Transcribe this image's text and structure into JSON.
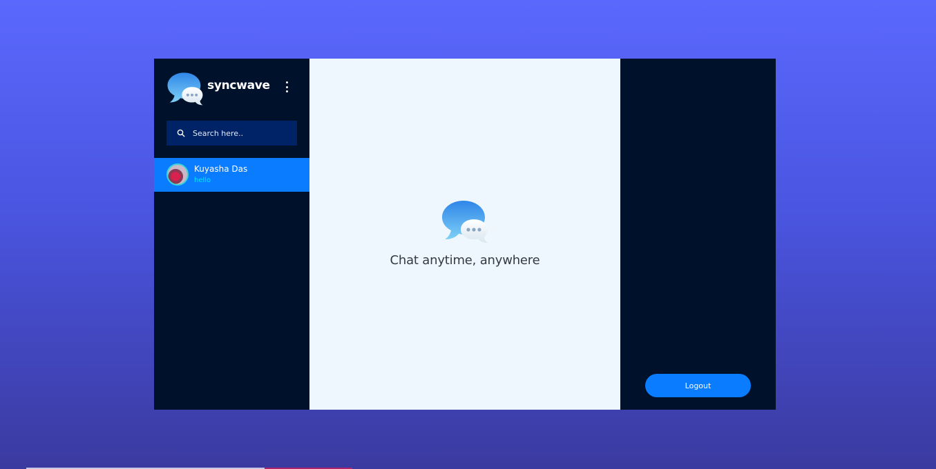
{
  "brand": {
    "name": "syncwave",
    "icon": "chat-bubbles-icon"
  },
  "sidebar": {
    "menu_icon": "vertical-dots-icon",
    "search": {
      "placeholder": "Search here..",
      "value": "",
      "icon": "search-icon"
    },
    "contacts": [
      {
        "name": "Kuyasha Das",
        "last_message": "hello",
        "active": true
      }
    ]
  },
  "main": {
    "welcome_text": "Chat anytime, anywhere",
    "icon": "chat-bubbles-icon"
  },
  "right_panel": {
    "logout_label": "Logout"
  },
  "colors": {
    "accent": "#0a7cff",
    "panel_dark": "#00112b",
    "search_bg": "#002266",
    "message_preview": "#00e5ff",
    "center_bg": "#eef6fe"
  }
}
